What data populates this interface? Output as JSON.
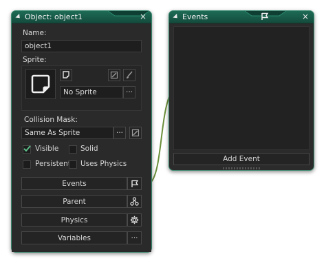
{
  "object_panel": {
    "title": "Object: object1",
    "close": "×",
    "name_label": "Name:",
    "name_value": "object1",
    "sprite_label": "Sprite:",
    "sprite_value": "No Sprite",
    "sprite_menu": "···",
    "collision_label": "Collision Mask:",
    "collision_value": "Same As Sprite",
    "collision_menu": "···",
    "checkboxes": [
      {
        "label": "Visible",
        "checked": true
      },
      {
        "label": "Solid",
        "checked": false
      },
      {
        "label": "Persistent",
        "checked": false
      },
      {
        "label": "Uses Physics",
        "checked": false
      }
    ],
    "buttons": {
      "events": "Events",
      "parent": "Parent",
      "physics": "Physics",
      "variables": "Variables",
      "variables_menu": "···"
    }
  },
  "events_panel": {
    "title": "Events",
    "close": "×",
    "add_event": "Add Event"
  },
  "colors": {
    "accent": "#1d6b55",
    "border": "#3a8a6f",
    "panel_bg": "#2b2b2b",
    "check_green": "#5cc08a"
  }
}
